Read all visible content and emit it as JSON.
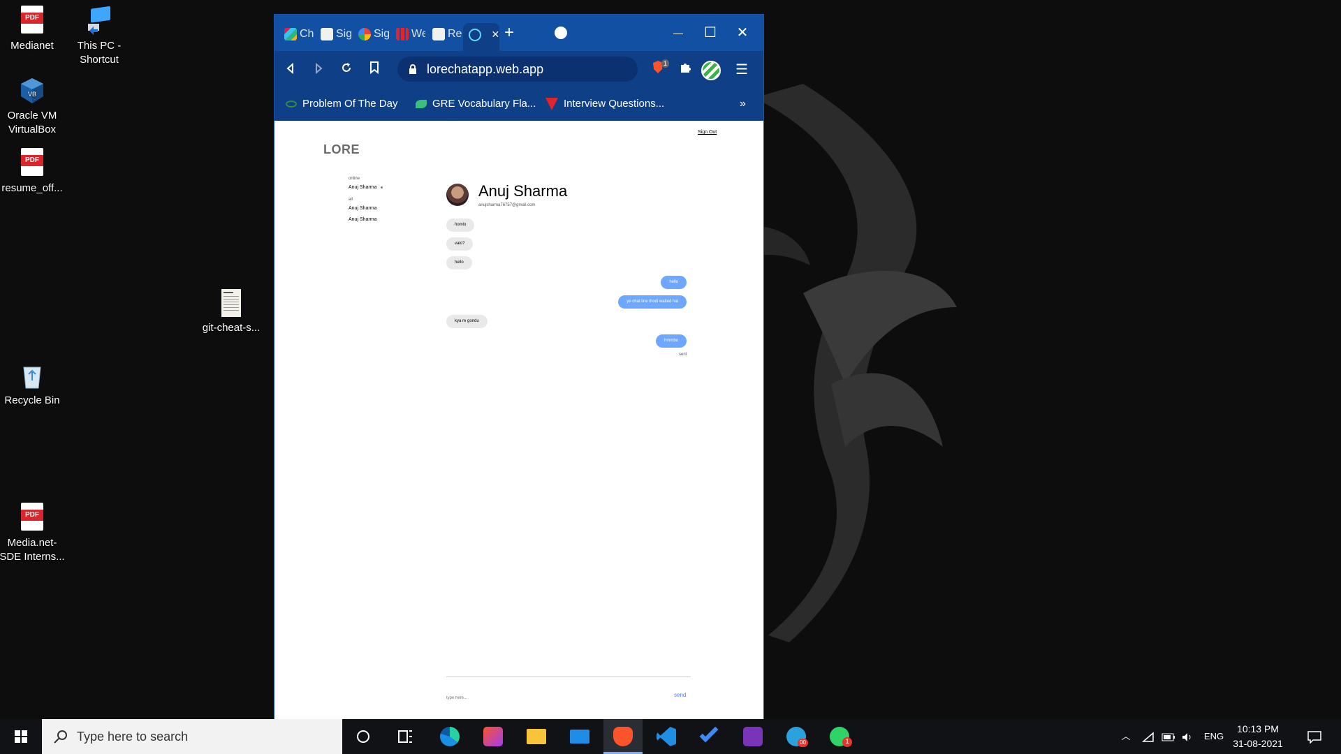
{
  "desktop": {
    "icons": [
      {
        "label_line1": "Medianet",
        "label_line2": "",
        "icon": "pdf-icon",
        "pdf_text": "PDF"
      },
      {
        "label_line1": "This PC -",
        "label_line2": "Shortcut",
        "icon": "this-pc-icon"
      },
      {
        "label_line1": "Oracle VM",
        "label_line2": "VirtualBox",
        "icon": "virtualbox-icon"
      },
      {
        "label_line1": "resume_off...",
        "label_line2": "",
        "icon": "pdf-icon",
        "pdf_text": "PDF"
      },
      {
        "label_line1": "git-cheat-s...",
        "label_line2": "",
        "icon": "document-icon"
      },
      {
        "label_line1": "Recycle Bin",
        "label_line2": "",
        "icon": "recycle-bin-icon"
      },
      {
        "label_line1": "Media.net-",
        "label_line2": "SDE Interns...",
        "icon": "pdf-icon",
        "pdf_text": "PDF"
      }
    ]
  },
  "browser": {
    "tabs": [
      {
        "label": "Cha",
        "icon": "slack-icon"
      },
      {
        "label": "Sign",
        "icon": "emblem-icon"
      },
      {
        "label": "Sign",
        "icon": "google-icon"
      },
      {
        "label": "We",
        "icon": "grid-icon"
      },
      {
        "label": "Res",
        "icon": "emblem-icon"
      },
      {
        "label": "",
        "icon": "react-icon",
        "active": true
      }
    ],
    "close_tab_glyph": "✕",
    "new_tab_glyph": "+",
    "window_controls": {
      "minimize": "—",
      "maximize": "☐",
      "close": "✕"
    },
    "url": "lorechatapp.web.app",
    "shield_count": "1",
    "bookmarks": [
      {
        "label": "Problem Of The Day",
        "icon": "gfg-icon"
      },
      {
        "label": "GRE Vocabulary Fla...",
        "icon": "vocab-icon"
      },
      {
        "label": "Interview Questions...",
        "icon": "interview-icon"
      }
    ],
    "more_bookmarks": "»"
  },
  "app": {
    "brand": "LORE",
    "sign_out": "Sign Out",
    "sidebar": {
      "online_header": "online",
      "online_users": [
        "Anuj Sharma"
      ],
      "all_header": "all",
      "all_users": [
        "Anuj Sharma",
        "Anuj Sharma"
      ]
    },
    "chat": {
      "name": "Anuj Sharma",
      "email": "anujsharma76757@gmail.com",
      "messages": [
        {
          "text": "homlo",
          "from": "them"
        },
        {
          "text": "valo?",
          "from": "them"
        },
        {
          "text": "hello",
          "from": "them"
        },
        {
          "text": "hello",
          "from": "me"
        },
        {
          "text": "ye chat line thodi waited hai",
          "from": "me"
        },
        {
          "text": "kya re gondu",
          "from": "them"
        },
        {
          "text": "hmmbo",
          "from": "me"
        }
      ],
      "status": "sent",
      "input_placeholder": "type here...",
      "send_label": "send"
    }
  },
  "taskbar": {
    "search_placeholder": "Type here to search",
    "telegram_badge": "00",
    "whatsapp_badge": "1",
    "language": "ENG",
    "time": "10:13 PM",
    "date": "31-08-2021"
  },
  "colors": {
    "browser_chrome": "#0f3f86",
    "outgoing_bubble": "#6ea7ff",
    "incoming_bubble": "#e9e9e9",
    "send_link": "#4a7fe8"
  }
}
